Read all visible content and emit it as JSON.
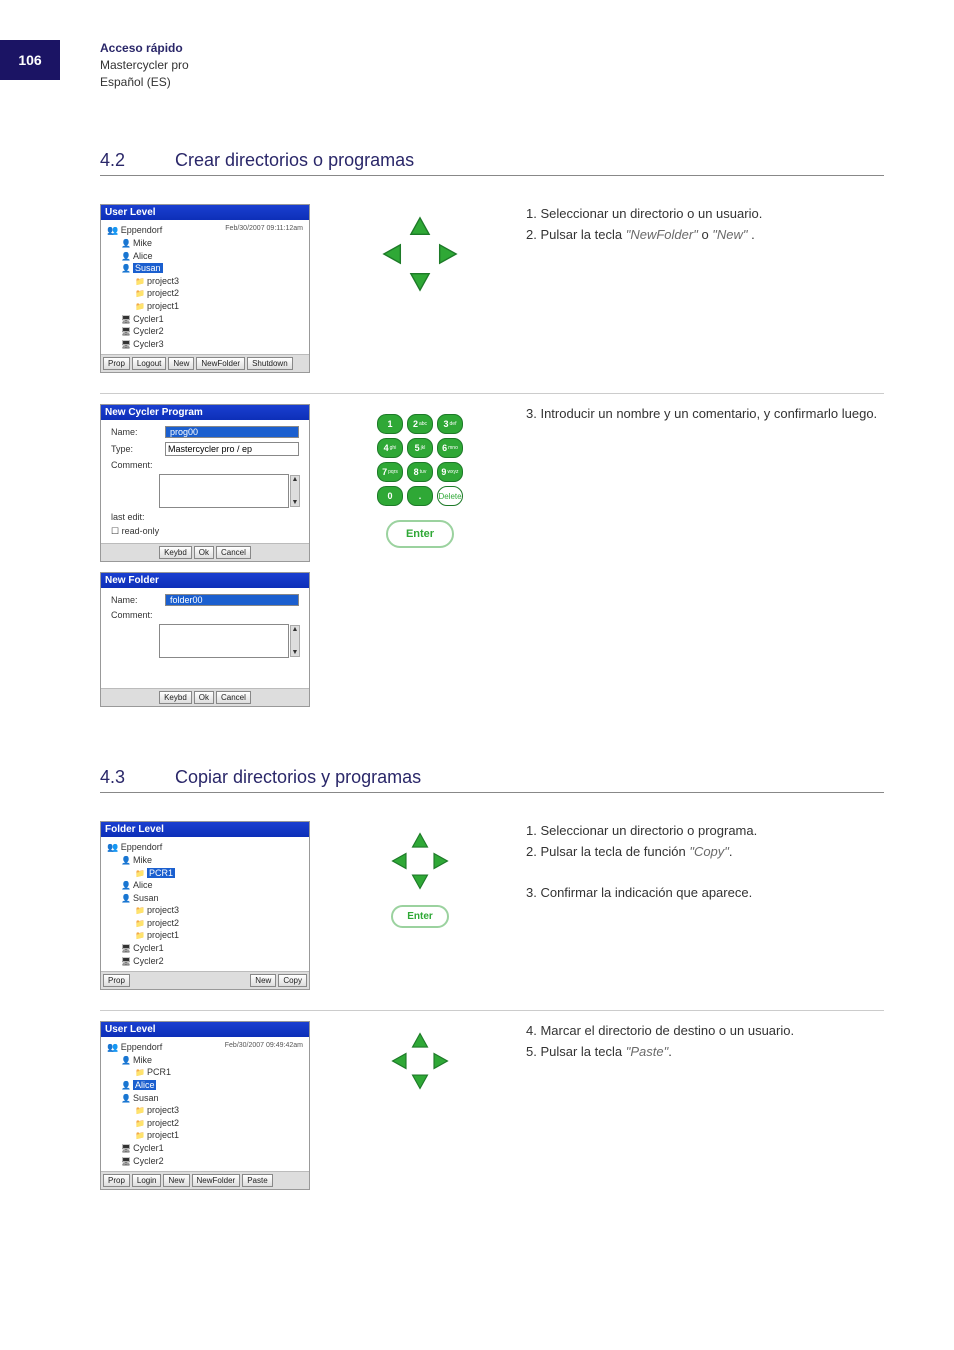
{
  "page_number": "106",
  "header": {
    "title": "Acceso rápido",
    "product": "Mastercycler pro",
    "lang": "Español (ES)"
  },
  "section_4_2": {
    "num": "4.2",
    "title": "Crear directorios o programas",
    "step1": {
      "win_title": "User Level",
      "timestamp": "Feb/30/2007 09:11:12am",
      "root": "Eppendorf",
      "users": [
        "Mike",
        "Alice",
        "Susan"
      ],
      "selected_user": "Susan",
      "folders": [
        "project3",
        "project2",
        "project1"
      ],
      "cyclers": [
        "Cycler1",
        "Cycler2",
        "Cycler3"
      ],
      "buttons": [
        "Prop",
        "Logout",
        "New",
        "NewFolder",
        "Shutdown"
      ],
      "text1": "1. Seleccionar un directorio o un usuario.",
      "text2a": "2. Pulsar la tecla ",
      "text2b": "\"NewFolder\"",
      "text2c": " o ",
      "text2d": "\"New\"",
      "text2e": "."
    },
    "step2": {
      "win_title": "New Cycler Program",
      "name_label": "Name:",
      "name_value": "prog00",
      "type_label": "Type:",
      "type_value": "Mastercycler pro / ep",
      "comment_label": "Comment:",
      "lastedit_label": "last edit:",
      "readonly_label": "read-only",
      "buttons": [
        "Keybd",
        "Ok",
        "Cancel"
      ],
      "win2_title": "New Folder",
      "win2_name_value": "folder00",
      "keypad": {
        "keys": [
          {
            "n": "1",
            "s": ""
          },
          {
            "n": "2",
            "s": "abc"
          },
          {
            "n": "3",
            "s": "def"
          },
          {
            "n": "4",
            "s": "ghi"
          },
          {
            "n": "5",
            "s": "jkl"
          },
          {
            "n": "6",
            "s": "mno"
          },
          {
            "n": "7",
            "s": "pqrs"
          },
          {
            "n": "8",
            "s": "tuv"
          },
          {
            "n": "9",
            "s": "wxyz"
          },
          {
            "n": "0",
            "s": ""
          },
          {
            "n": ".",
            "s": ""
          }
        ],
        "delete": "Delete",
        "enter": "Enter"
      },
      "text1": "3. Introducir un nombre y un comentario, y confirmarlo luego."
    }
  },
  "section_4_3": {
    "num": "4.3",
    "title": "Copiar directorios y programas",
    "step1": {
      "win_title": "Folder Level",
      "root": "Eppendorf",
      "mike_folder": "PCR1",
      "selected": "PCR1",
      "users": [
        "Mike",
        "Alice",
        "Susan"
      ],
      "folders": [
        "project3",
        "project2",
        "project1"
      ],
      "cyclers": [
        "Cycler1",
        "Cycler2"
      ],
      "buttons": [
        "Prop",
        "New",
        "Copy"
      ],
      "enter": "Enter",
      "text1": "1. Seleccionar un directorio o programa.",
      "text2a": "2. Pulsar la tecla de función ",
      "text2b": "\"Copy\"",
      "text2c": ".",
      "text3": "3. Confirmar la indicación que aparece."
    },
    "step2": {
      "win_title": "User Level",
      "timestamp": "Feb/30/2007 09:49:42am",
      "root": "Eppendorf",
      "users": [
        "Mike",
        "Alice",
        "Susan"
      ],
      "mike_folder": "PCR1",
      "selected_user": "Alice",
      "folders": [
        "project3",
        "project2",
        "project1"
      ],
      "cyclers": [
        "Cycler1",
        "Cycler2"
      ],
      "buttons": [
        "Prop",
        "Login",
        "New",
        "NewFolder",
        "Paste"
      ],
      "text1": "4. Marcar el directorio de destino o un usuario.",
      "text2a": "5. Pulsar la tecla ",
      "text2b": "\"Paste\"",
      "text2c": "."
    }
  }
}
